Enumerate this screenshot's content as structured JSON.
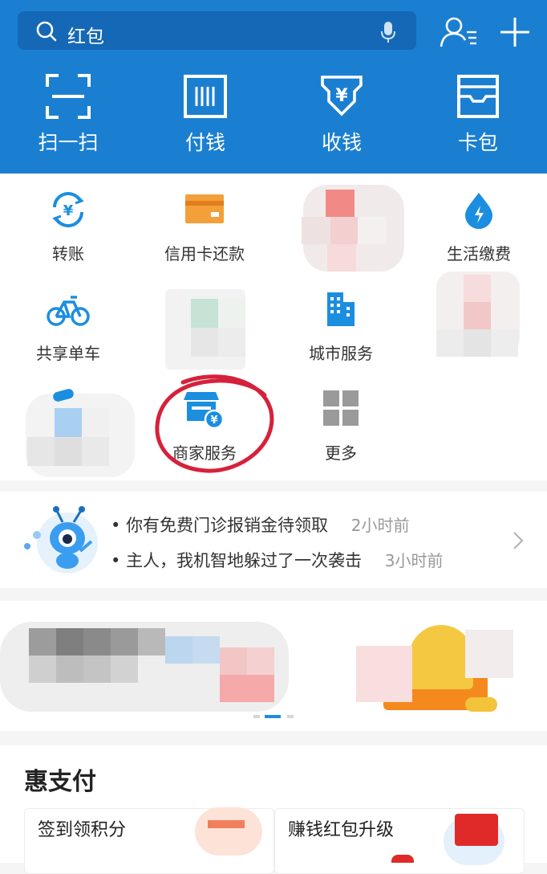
{
  "search": {
    "text": "红包"
  },
  "top_actions": [
    {
      "label": "扫一扫",
      "icon": "scan-icon"
    },
    {
      "label": "付钱",
      "icon": "pay-icon"
    },
    {
      "label": "收钱",
      "icon": "receive-icon"
    },
    {
      "label": "卡包",
      "icon": "cardpack-icon"
    }
  ],
  "services": [
    {
      "label": "转账",
      "icon": "transfer-icon"
    },
    {
      "label": "信用卡还款",
      "icon": "credit-card-icon"
    },
    {
      "label": "生活缴费",
      "icon": "utility-icon"
    },
    {
      "label": "共享单车",
      "icon": "bike-icon"
    },
    {
      "label": "城市服务",
      "icon": "city-icon"
    },
    {
      "label": "商家服务",
      "icon": "merchant-icon"
    },
    {
      "label": "更多",
      "icon": "more-grid-icon"
    }
  ],
  "news": [
    {
      "text": "你有免费门诊报销金待领取",
      "time": "2小时前"
    },
    {
      "text": "主人，我机智地躲过了一次袭击",
      "time": "3小时前"
    }
  ],
  "hui": {
    "title": "惠支付",
    "cards": [
      {
        "title": "签到领积分"
      },
      {
        "title": "赚钱红包升级"
      }
    ]
  },
  "colors": {
    "brand_blue": "#1b7fd1",
    "annotation_red": "#d6213a"
  }
}
